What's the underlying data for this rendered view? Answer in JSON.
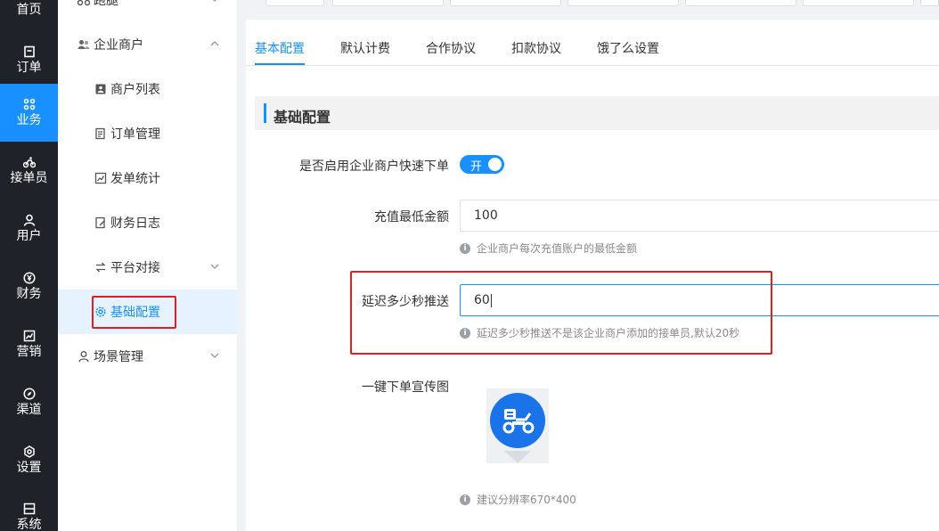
{
  "rail": {
    "items": [
      {
        "label": "首页",
        "icon": "home-icon"
      },
      {
        "label": "订单",
        "icon": "order-icon"
      },
      {
        "label": "业务",
        "icon": "business-icon"
      },
      {
        "label": "接单员",
        "icon": "rider-icon"
      },
      {
        "label": "用户",
        "icon": "user-icon"
      },
      {
        "label": "财务",
        "icon": "yen-icon"
      },
      {
        "label": "营销",
        "icon": "chart-icon"
      },
      {
        "label": "渠道",
        "icon": "channel-icon"
      },
      {
        "label": "设置",
        "icon": "gear-icon"
      },
      {
        "label": "系统",
        "icon": "system-icon"
      }
    ],
    "active_color": "#1890ff"
  },
  "menu": {
    "top_cropped": "跑腿",
    "group_enterprise": "企业商户",
    "merchant_list": "商户列表",
    "order_manage": "订单管理",
    "dispatch_stats": "发单统计",
    "finance_log": "财务日志",
    "platform_link": "平台对接",
    "basic_config": "基础配置",
    "scene_manage": "场景管理"
  },
  "tabs": [
    "基本配置",
    "默认计费",
    "合作协议",
    "扣款协议",
    "饿了么设置"
  ],
  "section_title": "基础配置",
  "form": {
    "enable_label": "是否启用企业商户快速下单",
    "enable_switch": "开",
    "min_recharge_label": "充值最低金额",
    "min_recharge_value": "100",
    "min_recharge_hint": "企业商户每次充值账户的最低金额",
    "delay_label": "延迟多少秒推送",
    "delay_value": "60",
    "delay_hint": "延迟多少秒推送不是该企业商户添加的接单员,默认20秒",
    "promo_label": "一键下单宣传图",
    "promo_hint": "建议分辨率670*400"
  },
  "colors": {
    "primary": "#1890ff",
    "rail_bg": "#1f2229",
    "highlight_red": "#e02020"
  }
}
